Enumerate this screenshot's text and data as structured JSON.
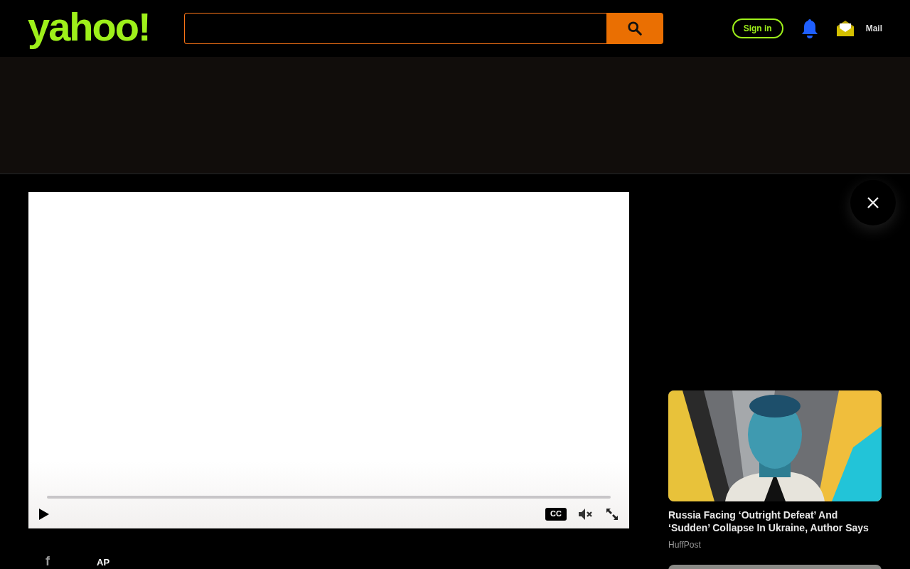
{
  "header": {
    "logo": "yahoo!",
    "sign_in": "Sign in",
    "mail": "Mail"
  },
  "video": {
    "progress": {
      "level": 0
    },
    "captions": "CC"
  },
  "share": {
    "facebook": "f",
    "source": "AP"
  },
  "related": [
    {
      "title": "Russia Facing ‘Outright Defeat’ And ‘Sudden’ Collapse In Ukraine, Author Says",
      "source": "HuffPost"
    }
  ]
}
